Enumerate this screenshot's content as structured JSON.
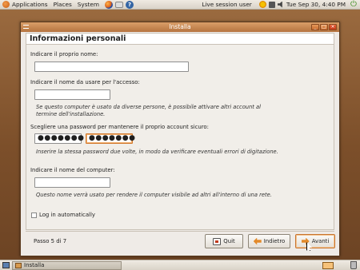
{
  "top_panel": {
    "menus": [
      "Applications",
      "Places",
      "System"
    ],
    "session_label": "Live session user",
    "clock": "Tue Sep 30,  4:40 PM"
  },
  "window": {
    "title": "Installa",
    "heading": "Informazioni personali",
    "name_prompt": "Indicare il proprio nome:",
    "name_value": "",
    "login_prompt": "Indicare il nome da usare per l'accesso:",
    "login_value": "",
    "login_note": "Se questo computer è usato da diverse persone, è possibile attivare altri account al termine dell'installazione.",
    "password_prompt": "Scegliere una password per mantenere il proprio account sicuro:",
    "password_value": "●●●●●●●",
    "password_confirm_value": "●●●●●●●",
    "password_note": "Inserire la stessa password due volte, in modo da verificare eventuali errori di digitazione.",
    "computer_prompt": "Indicare il nome del computer:",
    "computer_value": "",
    "computer_note": "Questo nome verrà usato per rendere il computer visibile ad altri all'interno di una rete.",
    "autologin_label": "Log in automatically",
    "autologin_checked": false,
    "step_label": "Passo 5 di 7",
    "quit_label": "Quit",
    "back_label": "Indietro",
    "forward_label": "Avanti"
  },
  "bottom_panel": {
    "task_label": "Installa"
  },
  "colors": {
    "accent": "#d2782c",
    "titlebar": "#c98350",
    "desktop": "#8a5a34"
  },
  "icons": [
    "ubuntu-logo-icon",
    "firefox-icon",
    "mail-icon",
    "help-icon",
    "update-icon",
    "network-icon",
    "volume-icon",
    "logout-icon",
    "quit-icon",
    "back-arrow-icon",
    "forward-arrow-icon",
    "show-desktop-icon",
    "workspace-icon",
    "trash-icon"
  ]
}
